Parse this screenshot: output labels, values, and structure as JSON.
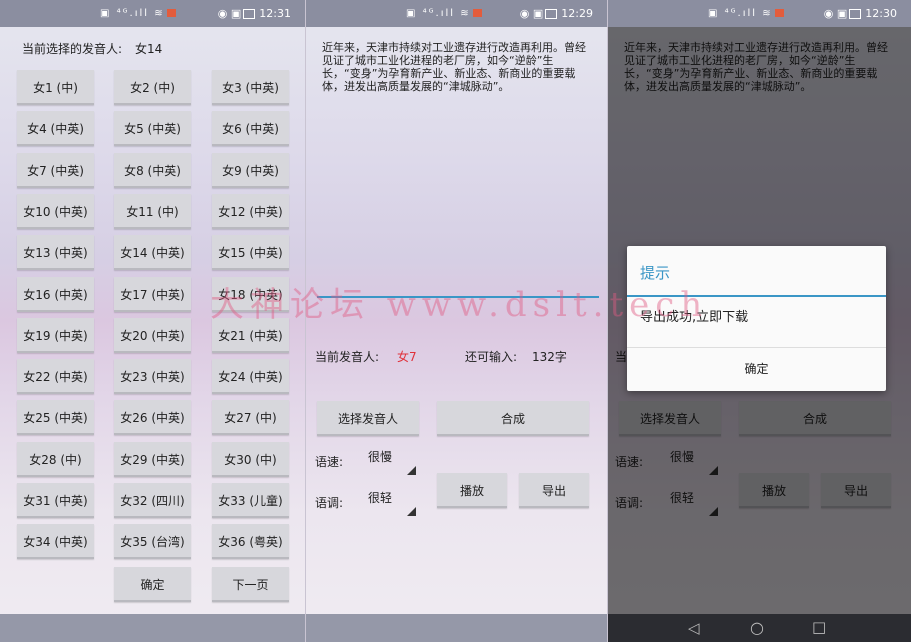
{
  "status": {
    "p1_time": "12:31",
    "p2_time": "12:29",
    "p3_time": "12:30",
    "left_icons": "▣ ⁴ᴳ.ıll ≋",
    "right_icons": "◉ ▣"
  },
  "left": {
    "current_label": "当前选择的发音人:",
    "current_value": "女14",
    "voices": [
      "女1 (中)",
      "女2 (中)",
      "女3 (中英)",
      "女4 (中英)",
      "女5 (中英)",
      "女6 (中英)",
      "女7 (中英)",
      "女8 (中英)",
      "女9 (中英)",
      "女10 (中英)",
      "女11 (中)",
      "女12 (中英)",
      "女13 (中英)",
      "女14 (中英)",
      "女15 (中英)",
      "女16 (中英)",
      "女17 (中英)",
      "女18 (中英)",
      "女19 (中英)",
      "女20 (中英)",
      "女21 (中英)",
      "女22 (中英)",
      "女23 (中英)",
      "女24 (中英)",
      "女25 (中英)",
      "女26 (中英)",
      "女27 (中)",
      "女28 (中)",
      "女29 (中英)",
      "女30 (中)",
      "女31 (中英)",
      "女32 (四川)",
      "女33 (儿童)",
      "女34 (中英)",
      "女35 (台湾)",
      "女36 (粤英)"
    ],
    "confirm": "确定",
    "next_page": "下一页"
  },
  "middle": {
    "paragraph": "近年来，天津市持续对工业遗存进行改造再利用。曾经见证了城市工业化进程的老厂房，如今“逆龄”生长，“变身”为孕育新产业、新业态、新商业的重要载体，进发出高质量发展的“津城脉动”。",
    "current_speaker_label": "当前发音人:",
    "current_speaker": "女7",
    "remaining_label": "还可输入:",
    "remaining_value": "132字",
    "select_speaker": "选择发音人",
    "synthesize": "合成",
    "speed_label": "语速:",
    "speed_value": "很慢",
    "pitch_label": "语调:",
    "pitch_value": "很轻",
    "play": "播放",
    "export": "导出"
  },
  "right": {
    "dialog_title": "提示",
    "dialog_message": "导出成功,立即下载",
    "dialog_ok": "确定",
    "peek_label": "当"
  },
  "watermark": "大神论坛  www.dslt.tech",
  "nav": {
    "back": "◁",
    "home": "○",
    "recent": "□"
  },
  "colors": {
    "accent": "#3a96c6",
    "speaker_red": "#e0313a"
  }
}
